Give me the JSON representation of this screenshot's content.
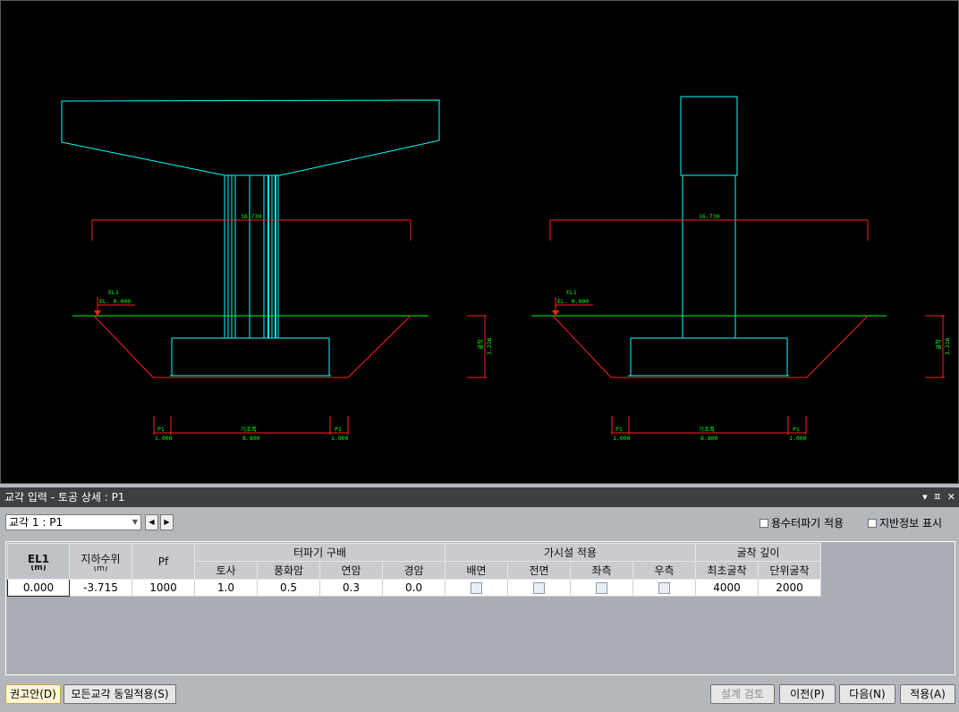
{
  "drawing": {
    "dim_width_left": "16.730",
    "dim_width_right": "16.730",
    "el_label": "EL1",
    "el_value": "EL. 0.000",
    "depth_label": "3.216",
    "depth_label_sub": "굴착",
    "bottom_left_p1": "P1",
    "bottom_left_p1_val": "1.000",
    "bottom_center_label": "기초폭",
    "bottom_center_val": "8.800",
    "bottom_right_p1": "P1",
    "bottom_right_p1_val": "1.000",
    "colors": {
      "structure": "#00ffff",
      "excavation": "#ff2020",
      "ground": "#00ff00"
    }
  },
  "panel": {
    "title": "교각 입력 - 토공 상세 : P1",
    "controls": [
      "▾",
      "ㅍ",
      "✕"
    ],
    "bridge_select_value": "교각 1 : P1",
    "nav_prev": "◀",
    "nav_next": "▶",
    "check_water_excavation": "용수터파기 적용",
    "check_ground_info": "지반정보 표시"
  },
  "table": {
    "h_el1": "EL1",
    "h_el1_unit": "(m)",
    "h_gwl": "지하수위",
    "h_gwl_unit": "(m)",
    "h_pf": "Pf",
    "h_slope_group": "터파기 구배",
    "h_temp_group": "가시설 적용",
    "h_depth_group": "굴착 깊이",
    "h_soil": "토사",
    "h_weathered": "풍화암",
    "h_soft_rock": "연암",
    "h_hard_rock": "경암",
    "h_back": "배면",
    "h_front": "전면",
    "h_left": "좌측",
    "h_right": "우측",
    "h_min_depth": "최초굴착",
    "h_unit_depth": "단위굴착",
    "row": {
      "el1": "0.000",
      "gwl": "-3.715",
      "pf": "1000",
      "soil": "1.0",
      "weathered": "0.5",
      "soft_rock": "0.3",
      "hard_rock": "0.0",
      "min_depth": "4000",
      "unit_depth": "2000"
    }
  },
  "buttons": {
    "recommend": "권고안(D)",
    "apply_all": "모든교각 동일적용(S)",
    "design_check": "설계 검토",
    "prev": "이전(P)",
    "next": "다음(N)",
    "apply": "적용(A)"
  }
}
